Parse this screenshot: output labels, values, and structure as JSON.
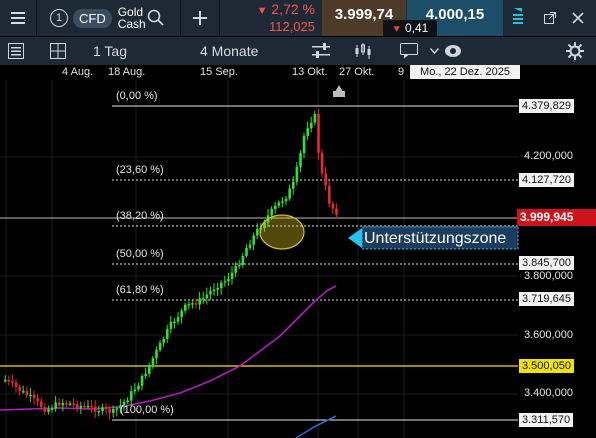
{
  "topbar": {
    "menu_icon": "hamburger-icon",
    "slot_number": "1",
    "instrument_type": "CFD",
    "instrument_name_line1": "Gold",
    "instrument_name_line2": "Cash",
    "change_percent": "2,72 %",
    "change_abs": "112,025",
    "bid": "3.999,74",
    "spread": "0,41",
    "ask": "4.000,15"
  },
  "toolbar": {
    "interval": "1 Tag",
    "range": "4 Monate"
  },
  "xaxis": {
    "labels": [
      "4 Aug.",
      "18 Aug.",
      "15 Sep.",
      "13 Okt.",
      "27 Okt.",
      "9"
    ],
    "crosshair_date": "Mo., 22 Dez. 2025"
  },
  "fibonacci": {
    "levels": [
      "(0,00 %)",
      "(23,60 %)",
      "(38,20 %)",
      "(50,00 %)",
      "(61,80 %)",
      "(100,00 %)"
    ],
    "prices": [
      "4.379,829",
      "4.127,720",
      "3.999,945",
      "3.845,700",
      "3.719,645",
      "3.311,570"
    ]
  },
  "yaxis": {
    "ticks": [
      "4.200,000",
      "3.800,000",
      "3.600,000",
      "3.400,000"
    ],
    "current_price": "3.999,945",
    "hline_price": "3.500,050"
  },
  "annotation": {
    "label": "Unterstützungszone"
  },
  "colors": {
    "up": "#2fe22f",
    "down": "#e8282f",
    "current_tag": "#d0121b",
    "hline_tag": "#f2e200",
    "ma_long": "#b01fc0",
    "ma_blue": "#2866c9",
    "highlight": "#d6c020"
  }
}
